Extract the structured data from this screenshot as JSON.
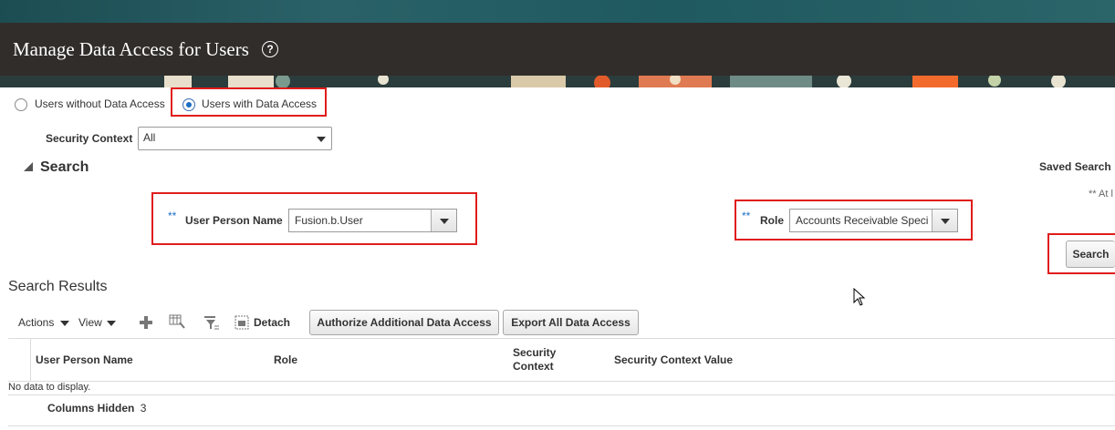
{
  "header": {
    "title": "Manage Data Access for Users",
    "help_icon": "?"
  },
  "radio_group": {
    "option1": "Users without Data Access",
    "option2": "Users with Data Access",
    "selected": "option2"
  },
  "security_context": {
    "label": "Security Context",
    "value": "All"
  },
  "search": {
    "title": "Search",
    "saved_search_label": "Saved Search",
    "required_note": "** At l",
    "user_person_name": {
      "marker": "**",
      "label": "User Person Name",
      "value": "Fusion.b.User"
    },
    "role": {
      "marker": "**",
      "label": "Role",
      "value": "Accounts Receivable Speci"
    },
    "search_button": "Search"
  },
  "results": {
    "title": "Search Results",
    "toolbar": {
      "actions": "Actions",
      "view": "View",
      "detach": "Detach",
      "authorize": "Authorize Additional Data Access",
      "export": "Export All Data Access"
    },
    "columns": [
      "User Person Name",
      "Role",
      "Security",
      "Context",
      "Security Context Value"
    ],
    "empty_text": "No data to display.",
    "columns_hidden_label": "Columns Hidden",
    "columns_hidden_count": "3"
  },
  "colors": {
    "accent": "#1c6ec2",
    "highlight": "#e01c1c",
    "titlebar": "#312d2a",
    "banner": "#1f5a60"
  }
}
